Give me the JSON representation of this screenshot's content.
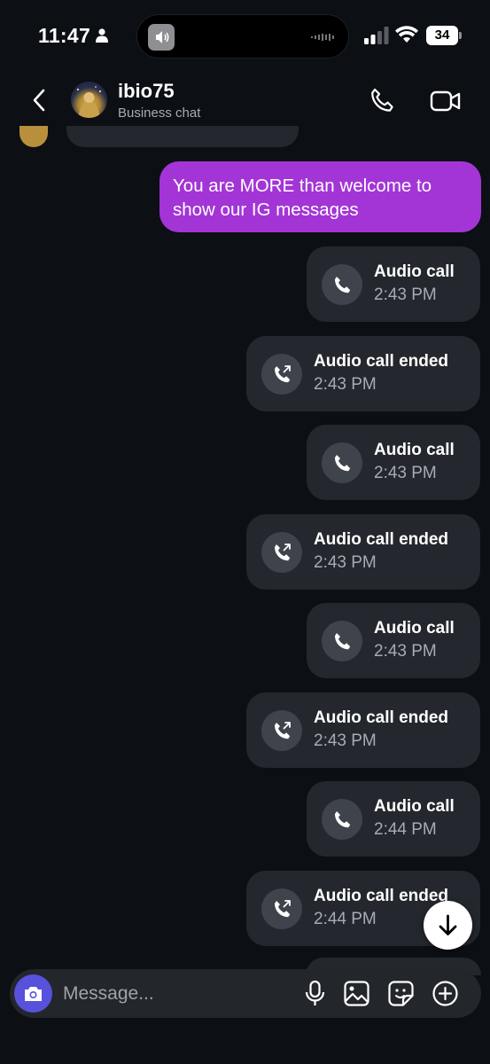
{
  "status_bar": {
    "time": "11:47",
    "battery": "34",
    "icons": [
      "person-icon",
      "speaker-icon",
      "signal-icon",
      "wifi-icon",
      "battery-icon"
    ]
  },
  "header": {
    "name": "ibio75",
    "subtitle": "Business chat",
    "icons": [
      "back-icon",
      "phone-icon",
      "video-icon"
    ]
  },
  "colors": {
    "background": "#0c0f14",
    "bubble_outgoing": "#a335d6",
    "bubble_call": "#24272d",
    "call_icon_circle": "#3f434b",
    "camera_button": "#5851db",
    "secondary_text": "#a8abb3"
  },
  "messages": {
    "outgoing_text": "You are MORE than welcome to show our IG messages",
    "calls": [
      {
        "title": "Audio call",
        "time": "2:43 PM",
        "icon": "phone-icon"
      },
      {
        "title": "Audio call ended",
        "time": "2:43 PM",
        "icon": "phone-outgoing-icon"
      },
      {
        "title": "Audio call",
        "time": "2:43 PM",
        "icon": "phone-icon"
      },
      {
        "title": "Audio call ended",
        "time": "2:43 PM",
        "icon": "phone-outgoing-icon"
      },
      {
        "title": "Audio call",
        "time": "2:43 PM",
        "icon": "phone-icon"
      },
      {
        "title": "Audio call ended",
        "time": "2:43 PM",
        "icon": "phone-outgoing-icon"
      },
      {
        "title": "Audio call",
        "time": "2:44 PM",
        "icon": "phone-icon"
      },
      {
        "title": "Audio call ended",
        "time": "2:44 PM",
        "icon": "phone-outgoing-icon"
      }
    ]
  },
  "composer": {
    "placeholder": "Message...",
    "icons": [
      "camera-icon",
      "microphone-icon",
      "gallery-icon",
      "sticker-icon",
      "plus-icon"
    ]
  },
  "scroll_button_icon": "arrow-down-icon"
}
